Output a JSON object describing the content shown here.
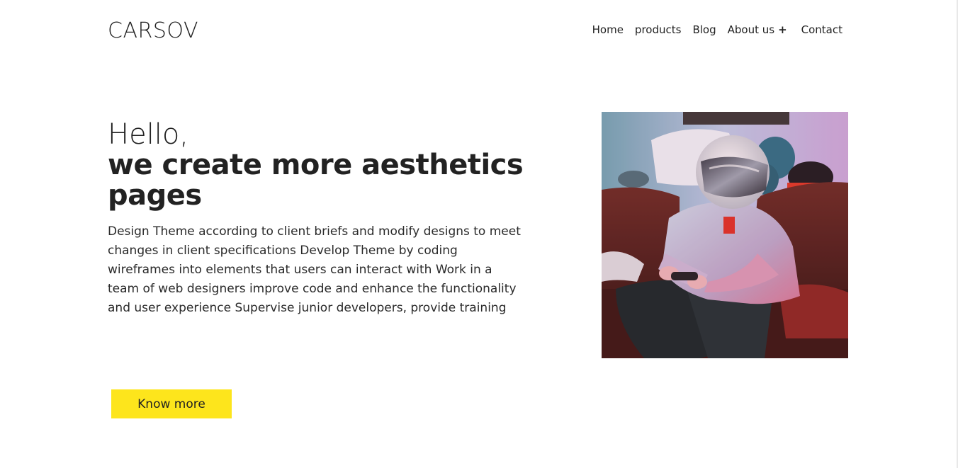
{
  "brand": {
    "logo": "CARSOV"
  },
  "nav": {
    "items": [
      {
        "label": "Home"
      },
      {
        "label": "products"
      },
      {
        "label": "Blog"
      },
      {
        "label": "About us",
        "icon": "plus-icon",
        "symbol": "+"
      },
      {
        "label": "Contact"
      }
    ]
  },
  "hero": {
    "greeting": "Hello,",
    "headline": "we create more aesthetics pages",
    "description": "Design Theme according to client briefs and modify designs to meet changes in client specifications Develop Theme by coding wireframes into elements that users can interact with Work in a team of web designers improve code and enhance the functionality and user experience Supervise junior developers, provide training",
    "cta_label": "Know more"
  },
  "colors": {
    "accent": "#fde51c",
    "text": "#222222",
    "background": "#ffffff"
  }
}
